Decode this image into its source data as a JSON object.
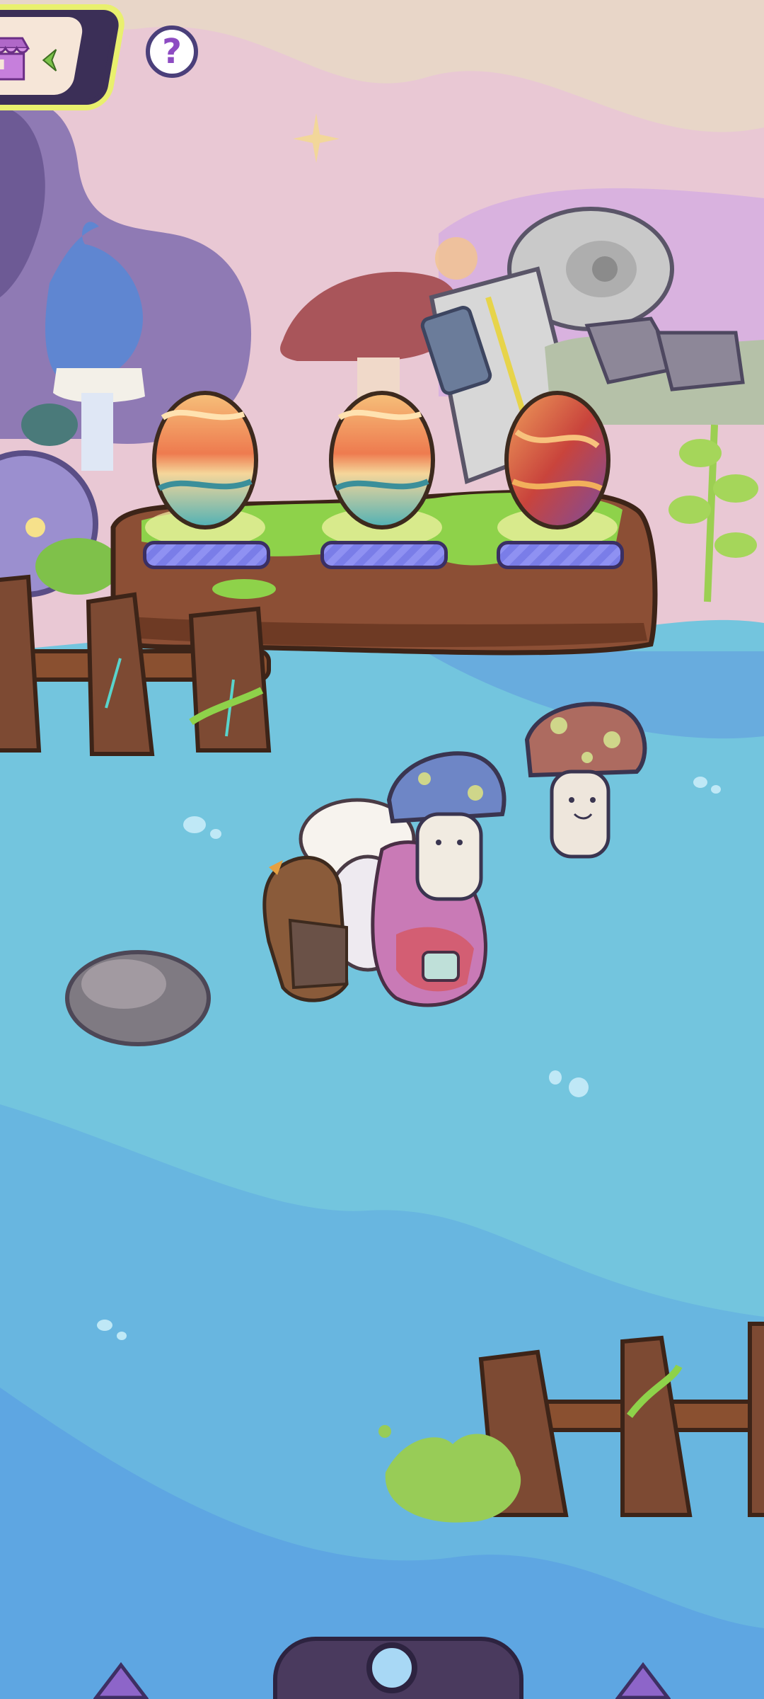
{
  "hud": {
    "shop_button": {
      "icon": "shop-stall-icon",
      "arrow_icon": "chevron-left-icon",
      "accent": "#e9f06e"
    },
    "help_button": {
      "label": "?",
      "icon": "question-icon",
      "color": "#8d4bc2"
    }
  },
  "eggs": [
    {
      "slot": 1,
      "style": "sunset-wave",
      "colors": [
        "#f6c07a",
        "#ee7b4f",
        "#4fb1b5"
      ]
    },
    {
      "slot": 2,
      "style": "sunset-wave",
      "colors": [
        "#f6c07a",
        "#ee7b4f",
        "#4fb1b5"
      ]
    },
    {
      "slot": 3,
      "style": "fire-swirl",
      "colors": [
        "#f0a05c",
        "#c9443c",
        "#7a4ca0"
      ]
    }
  ],
  "characters": [
    "chicken",
    "goose",
    "pink-bird",
    "blue-mushroom",
    "brown-mushroom"
  ],
  "navigation": {
    "left_arrow": "left-triangle-icon",
    "right_arrow": "right-triangle-icon"
  },
  "palette": {
    "water": "#74c6df",
    "sky": "#e9c8d4",
    "log": "#8c4f35",
    "moss": "#8ed24a"
  }
}
